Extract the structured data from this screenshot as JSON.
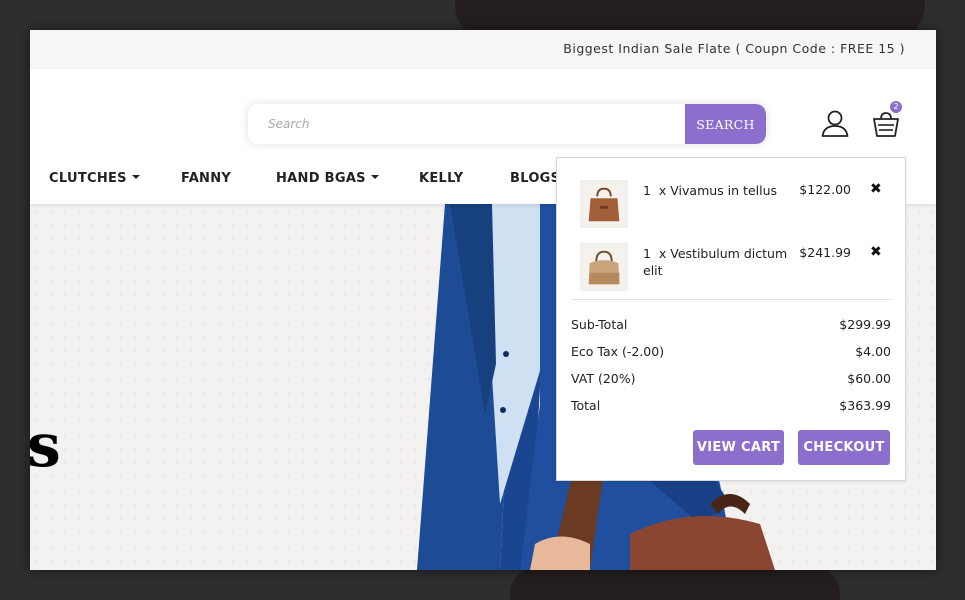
{
  "topbar": {
    "promo": "Biggest Indian Sale Flate ( Coupn Code : FREE 15 )"
  },
  "search": {
    "placeholder": "Search",
    "button": "SEARCH"
  },
  "header": {
    "cart_count": "2"
  },
  "nav": {
    "items": [
      {
        "label": "CLUTCHES",
        "dropdown": true
      },
      {
        "label": "FANNY",
        "dropdown": false
      },
      {
        "label": "HAND BGAS",
        "dropdown": true
      },
      {
        "label": "KELLY",
        "dropdown": false
      },
      {
        "label": "BLOGS",
        "dropdown": false
      }
    ]
  },
  "hero": {
    "letter": "s"
  },
  "cart": {
    "items": [
      {
        "qty": "1",
        "name": "x Vivamus in tellus",
        "price": "$122.00"
      },
      {
        "qty": "1",
        "name": "x Vestibulum dictum elit",
        "price": "$241.99"
      }
    ],
    "remove_glyph": "✖",
    "totals": [
      {
        "label": "Sub-Total",
        "value": "$299.99"
      },
      {
        "label": "Eco Tax (-2.00)",
        "value": "$4.00"
      },
      {
        "label": "VAT (20%)",
        "value": "$60.00"
      },
      {
        "label": "Total",
        "value": "$363.99"
      }
    ],
    "view_cart": "VIEW CART",
    "checkout": "CHECKOUT"
  },
  "colors": {
    "accent": "#8c6fcd",
    "topbar_bg": "#f6f6f6",
    "backdrop": "#2e2e2e"
  },
  "icons": {
    "account": "user-icon",
    "cart": "basket-icon",
    "remove": "close-icon"
  }
}
